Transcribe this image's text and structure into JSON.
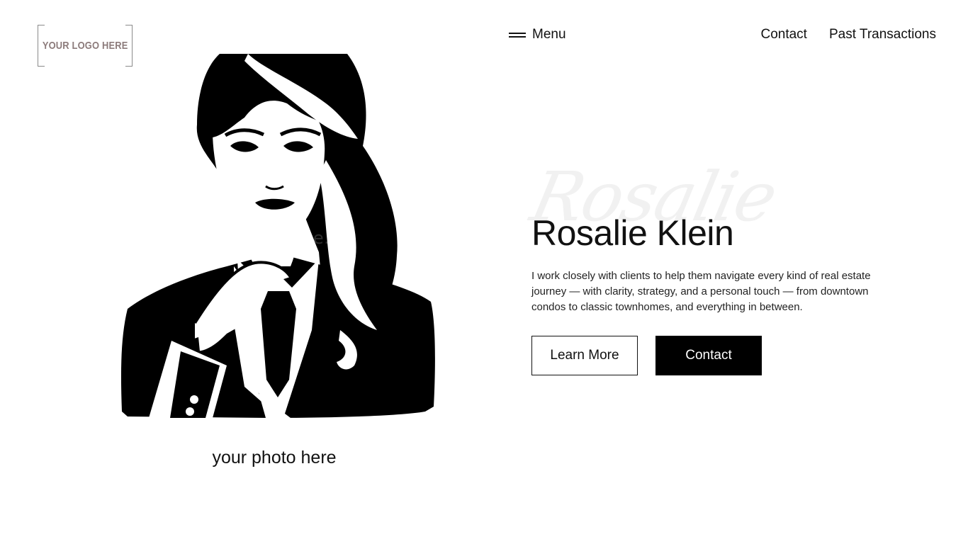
{
  "logo": {
    "text": "YOUR LOGO HERE"
  },
  "nav": {
    "menu_label": "Menu",
    "menu_icon": "hamburger-icon",
    "links": [
      "Contact",
      "Past Transactions"
    ]
  },
  "portrait": {
    "caption": "your photo here",
    "watermark": "dreamstime."
  },
  "hero": {
    "script_text": "Rosalie",
    "name": "Rosalie Klein",
    "bio": "I work closely with clients to help them navigate every kind of real estate journey — with clarity, strategy, and a personal touch — from downtown condos to classic townhomes, and everything in between.",
    "learn_more_label": "Learn More",
    "contact_label": "Contact"
  },
  "colors": {
    "background": "#ffffff",
    "text": "#111111",
    "button_solid": "#000000",
    "logo_text": "#8c7b7b"
  }
}
